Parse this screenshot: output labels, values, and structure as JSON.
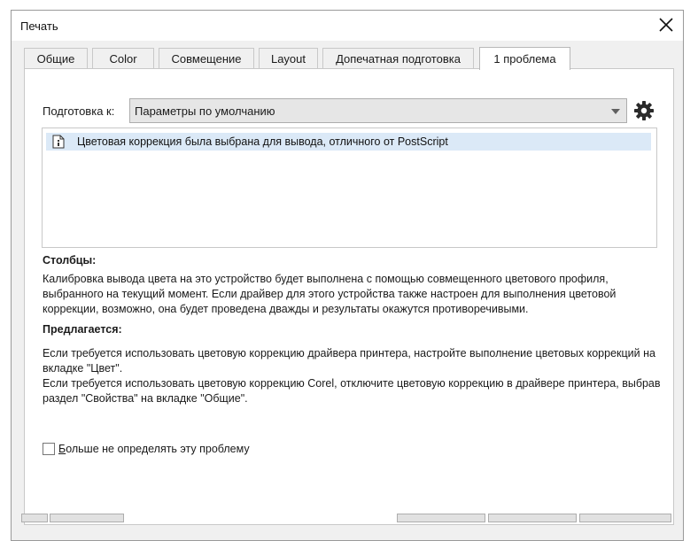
{
  "window": {
    "title": "Печать"
  },
  "tabs": [
    {
      "label": "Общие",
      "active": false
    },
    {
      "label": "Color",
      "active": false
    },
    {
      "label": "Совмещение",
      "active": false
    },
    {
      "label": "Layout",
      "active": false
    },
    {
      "label": "Допечатная подготовка",
      "active": false
    },
    {
      "label": "1 проблема",
      "active": true
    }
  ],
  "prepare": {
    "label": "Подготовка к:",
    "selected": "Параметры по умолчанию"
  },
  "issues": [
    {
      "text": "Цветовая коррекция была выбрана для вывода, отличного от PostScript",
      "icon": "document-info-icon"
    }
  ],
  "details": {
    "columns_heading": "Столбцы:",
    "columns_text": "Калибровка вывода цвета на это устройство будет выполнена с помощью совмещенного цветового профиля, выбранного на текущий момент. Если драйвер для этого устройства также настроен для выполнения цветовой коррекции, возможно, она будет проведена дважды и результаты окажутся противоречивыми.",
    "suggested_heading": "Предлагается:",
    "suggested_text_1": "Если требуется использовать цветовую коррекцию драйвера принтера, настройте выполнение цветовых коррекций на вкладке \"Цвет\".",
    "suggested_text_2": "Если требуется использовать цветовую коррекцию Corel, отключите цветовую коррекцию в драйвере принтера, выбрав раздел \"Свойства\" на вкладке \"Общие\"."
  },
  "checkbox": {
    "label_first": "Б",
    "label_rest": "ольше не определять эту проблему",
    "checked": false
  },
  "colors": {
    "selection": "#dbe9f7",
    "window_bg": "#f0f0f0",
    "panel_bg": "#ffffff"
  }
}
